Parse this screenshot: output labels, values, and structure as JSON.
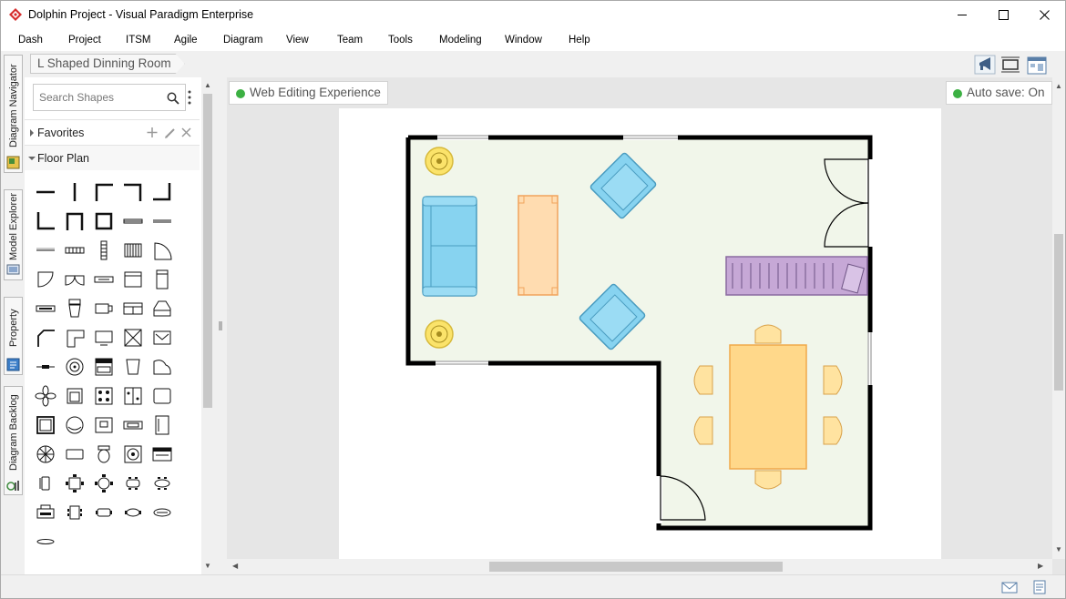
{
  "window": {
    "title": "Dolphin Project - Visual Paradigm Enterprise",
    "minimize": "minimize",
    "maximize": "maximize",
    "close": "close"
  },
  "menu": [
    "Dash",
    "Project",
    "ITSM",
    "Agile",
    "Diagram",
    "View",
    "Team",
    "Tools",
    "Modeling",
    "Window",
    "Help"
  ],
  "rail": [
    "Diagram Navigator",
    "Model Explorer",
    "Property",
    "Diagram Backlog"
  ],
  "breadcrumb": "L Shaped Dinning Room",
  "shapes_panel": {
    "search_placeholder": "Search Shapes",
    "groups": [
      {
        "label": "Favorites",
        "expanded": false
      },
      {
        "label": "Floor Plan",
        "expanded": true
      }
    ]
  },
  "canvas": {
    "left_pill": "Web Editing Experience",
    "right_pill": "Auto save: On",
    "status_color": "#3cb043"
  },
  "colors": {
    "sofa": "#87d3f0",
    "table": "#ffd88a",
    "rug": "#c6a8d6",
    "floor": "#f1f6ea"
  }
}
